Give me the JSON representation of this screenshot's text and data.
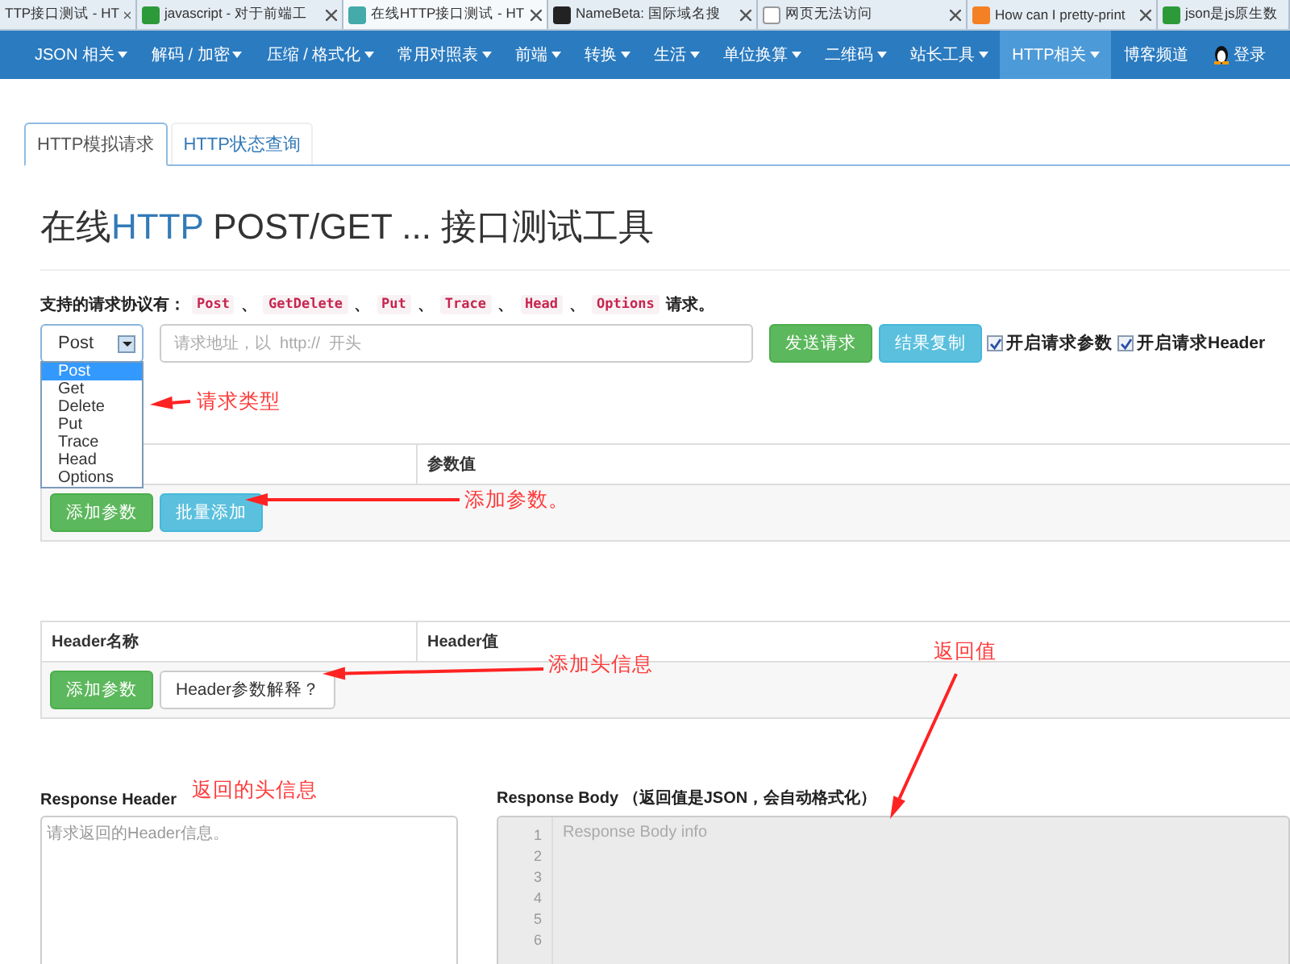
{
  "browser_tabs": [
    {
      "title": "TTP接口测试 - HT",
      "selected": false
    },
    {
      "title": "javascript - 对于前端工",
      "selected": false
    },
    {
      "title": "在线HTTP接口测试 - HT",
      "selected": true
    },
    {
      "title": "NameBeta: 国际域名搜",
      "selected": false
    },
    {
      "title": "网页无法访问",
      "selected": false
    },
    {
      "title": "How can I pretty-print",
      "selected": false
    },
    {
      "title": "json是js原生数",
      "selected": false
    }
  ],
  "nav": [
    {
      "label": "JSON 相关",
      "caret": true,
      "selected": false
    },
    {
      "label": "解码 / 加密",
      "caret": true,
      "selected": false
    },
    {
      "label": "压缩 / 格式化",
      "caret": true,
      "selected": false
    },
    {
      "label": "常用对照表",
      "caret": true,
      "selected": false
    },
    {
      "label": "前端",
      "caret": true,
      "selected": false
    },
    {
      "label": "转换",
      "caret": true,
      "selected": false
    },
    {
      "label": "生活",
      "caret": true,
      "selected": false
    },
    {
      "label": "单位换算",
      "caret": true,
      "selected": false
    },
    {
      "label": "二维码",
      "caret": true,
      "selected": false
    },
    {
      "label": "站长工具",
      "caret": true,
      "selected": false
    },
    {
      "label": "HTTP相关",
      "caret": true,
      "selected": true
    },
    {
      "label": "博客频道",
      "caret": false,
      "selected": false
    }
  ],
  "login": "登录",
  "page_tabs": [
    {
      "label": "HTTP模拟请求",
      "selected": true
    },
    {
      "label": "HTTP状态查询",
      "selected": false
    }
  ],
  "title": {
    "before": "在线",
    "highlight": "HTTP",
    "after": " POST/GET ... 接口测试工具"
  },
  "protocols": {
    "label": "支持的请求协议有：",
    "items": [
      "Post",
      "GetDelete",
      "Put",
      "Trace",
      "Head",
      "Options"
    ],
    "separator": "、",
    "suffix": "请求。"
  },
  "method_select": {
    "value": "Post",
    "expanded": true,
    "options": [
      {
        "label": "Post",
        "selected": true
      },
      {
        "label": "Get",
        "selected": false
      },
      {
        "label": "Delete",
        "selected": false
      },
      {
        "label": "Put",
        "selected": false
      },
      {
        "label": "Trace",
        "selected": false
      },
      {
        "label": "Head",
        "selected": false
      },
      {
        "label": "Options",
        "selected": false
      }
    ]
  },
  "url_field": {
    "placeholder": "请求地址，以  http://  开头"
  },
  "action_buttons": [
    {
      "label": "发送请求",
      "kind": "success"
    },
    {
      "label": "结果复制",
      "kind": "info"
    }
  ],
  "toggles": [
    {
      "label": "开启请求参数",
      "checked": true
    },
    {
      "label": "开启请求Header",
      "checked": true
    }
  ],
  "params_table": {
    "columns": [
      "",
      "参数值"
    ],
    "buttons": [
      {
        "label": "添加参数",
        "kind": "success"
      },
      {
        "label": "批量添加",
        "kind": "info"
      }
    ]
  },
  "header_table": {
    "columns": [
      "Header名称",
      "Header值"
    ],
    "buttons": [
      {
        "label": "添加参数",
        "kind": "success"
      },
      {
        "label": "Header参数解释？",
        "kind": "default"
      }
    ]
  },
  "response_header": {
    "label": "Response Header",
    "placeholder": "请求返回的Header信息。"
  },
  "response_body": {
    "label": "Response Body （返回值是JSON，会自动格式化）",
    "placeholder": "Response Body info",
    "line_numbers": [
      "1",
      "2",
      "3",
      "4",
      "5",
      "6"
    ]
  },
  "annotations": [
    {
      "text": "请求类型"
    },
    {
      "text": "添加参数。"
    },
    {
      "text": "添加头信息"
    },
    {
      "text": "返回值"
    },
    {
      "text": "返回的头信息"
    }
  ]
}
